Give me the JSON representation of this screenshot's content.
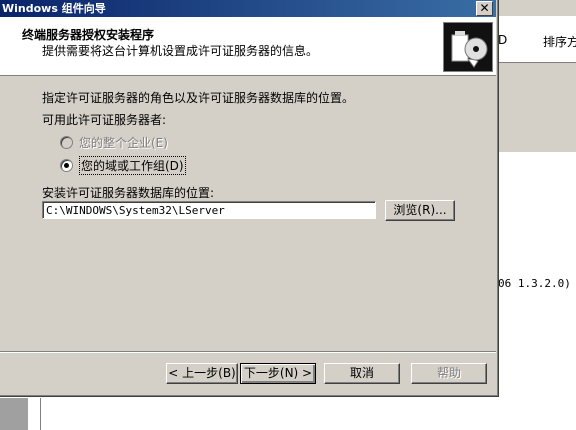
{
  "background": {
    "column_prev": "D",
    "column_sort": "排序方",
    "version_text": "06 1.3.2.0)"
  },
  "dialog": {
    "title": "Windows 组件向导",
    "close_glyph": "✕",
    "header": {
      "title": "终端服务器授权安装程序",
      "subtitle": "提供需要将这台计算机设置成许可证服务器的信息。"
    },
    "instruction": "指定许可证服务器的角色以及许可证服务器数据库的位置。",
    "role_label": "可用此许可证服务器者:",
    "options": [
      {
        "label": "您的整个企业(E)",
        "checked": false,
        "enabled": false
      },
      {
        "label": "您的域或工作组(D)",
        "checked": true,
        "enabled": true
      }
    ],
    "db_location_label": "安装许可证服务器数据库的位置:",
    "db_path": "C:\\WINDOWS\\System32\\LServer",
    "browse_label": "浏览(R)...",
    "buttons": {
      "back": "< 上一步(B)",
      "next": "下一步(N) >",
      "cancel": "取消",
      "help": "帮助"
    }
  },
  "colors": {
    "titlebar": "#0a246a",
    "face": "#d4d0c8"
  }
}
